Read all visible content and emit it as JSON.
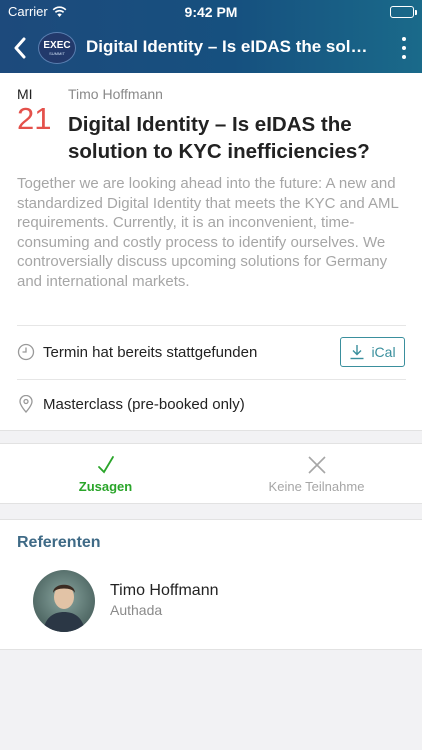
{
  "status_bar": {
    "carrier": "Carrier",
    "time": "9:42 PM"
  },
  "navbar": {
    "back_icon": "chevron-left-icon",
    "logo_text": "EXEC",
    "logo_subtext": "SUMMIT",
    "title": "Digital Identity – Is eIDAS the solution to KYC inefficiencies?",
    "more_icon": "more-vertical-icon"
  },
  "event": {
    "day": "MI",
    "date_number": "21",
    "author": "Timo Hoffmann",
    "title": "Digital Identity – Is eIDAS the solution to KYC inefficiencies?",
    "description": "Together we are looking ahead into the future: A new and standardized Digital Identity that meets the KYC and AML requirements. Currently, it is an inconvenient, time-consuming and costly process to identify ourselves. We controversially discuss upcoming solutions for Germany and international markets.",
    "status_text": "Termin hat bereits stattgefunden",
    "ical_label": "iCal",
    "location": "Masterclass (pre-booked only)"
  },
  "rsvp": {
    "accept_label": "Zusagen",
    "decline_label": "Keine Teilnahme"
  },
  "speakers": {
    "heading": "Referenten",
    "items": [
      {
        "name": "Timo Hoffmann",
        "company": "Authada"
      }
    ]
  },
  "colors": {
    "accent_red": "#e4514b",
    "accent_teal": "#3a8f9d",
    "accept_green": "#2aa52a",
    "heading_blue": "#3f6a86"
  }
}
